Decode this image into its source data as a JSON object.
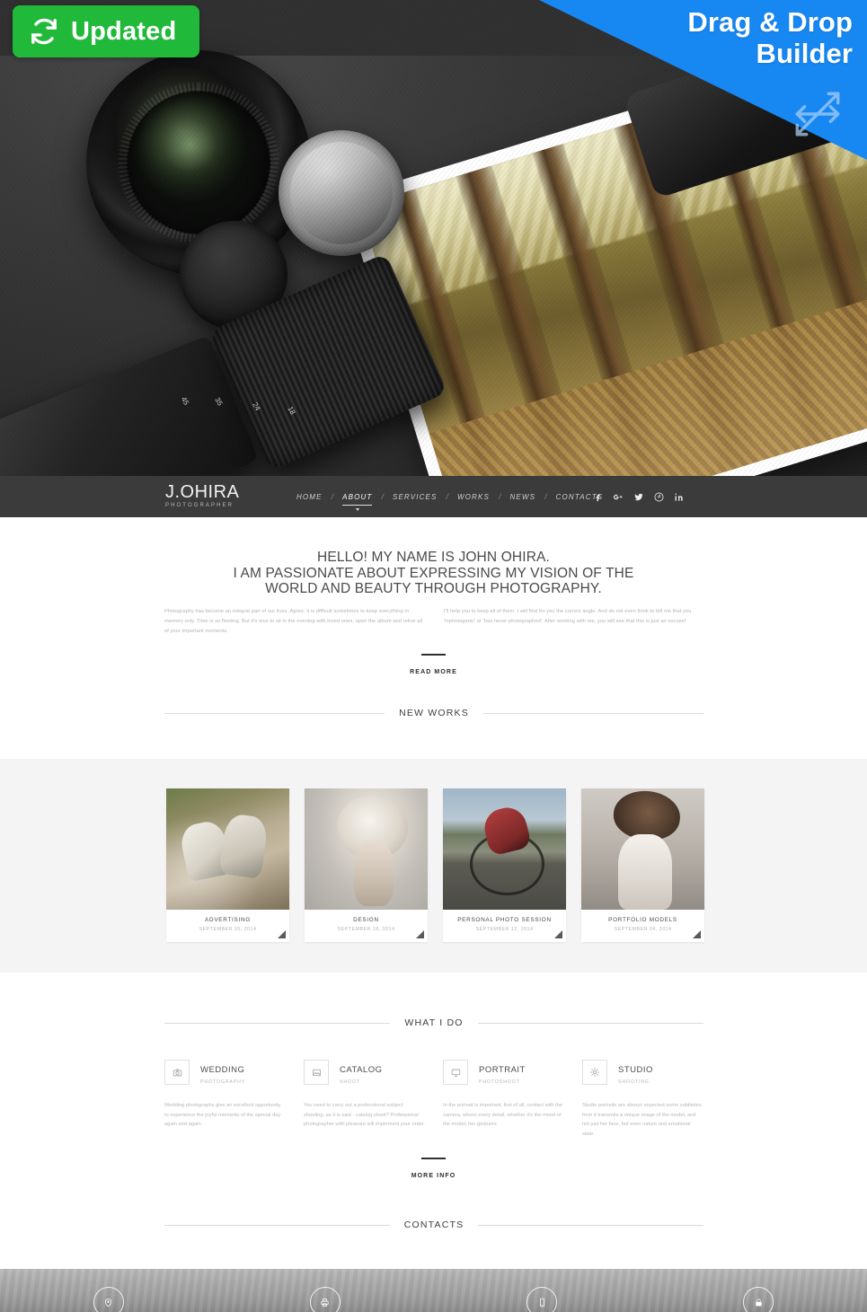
{
  "badges": {
    "updated_label": "Updated",
    "updated_icon": "refresh-icon",
    "updated_color": "#20b93a",
    "builder_line1": "Drag & Drop",
    "builder_line2": "Builder",
    "builder_color": "#1787f2",
    "builder_icon": "four-way-arrow-icon"
  },
  "nav": {
    "brand_title": "J.OHIRA",
    "brand_subtitle": "PHOTOGRAPHER",
    "separator": "/",
    "items": [
      {
        "label": "HOME",
        "active": false
      },
      {
        "label": "ABOUT",
        "active": true
      },
      {
        "label": "SERVICES",
        "active": false
      },
      {
        "label": "WORKS",
        "active": false
      },
      {
        "label": "NEWS",
        "active": false
      },
      {
        "label": "CONTACTS",
        "active": false
      }
    ],
    "social": [
      {
        "name": "facebook-icon",
        "glyph": "f"
      },
      {
        "name": "google-plus-icon",
        "glyph": "g+"
      },
      {
        "name": "twitter-icon",
        "glyph": "t"
      },
      {
        "name": "pinterest-icon",
        "glyph": "p"
      },
      {
        "name": "linkedin-icon",
        "glyph": "in"
      }
    ]
  },
  "intro": {
    "heading_line1": "HELLO! MY NAME IS JOHN OHIRA.",
    "heading_line2": "I AM PASSIONATE ABOUT EXPRESSING MY VISION OF THE",
    "heading_line3": "WORLD AND BEAUTY THROUGH PHOTOGRAPHY.",
    "paragraph_left": "Photography has become an integral part of our lives. Agree, it is difficult sometimes to keep everything in memory only. Time is so fleeting. But it's nice to sit in the evening with loved ones, open the album and relive all of your important moments.",
    "paragraph_right": "I'll help you to keep all of them. I will find for you the correct angle. And do not even think to tell me that you 'inphotogenic' or 'has never photographed'. After working with me, you will see that this is just an excuse!",
    "read_more_label": "READ MORE"
  },
  "new_works": {
    "section_title": "NEW WORKS",
    "items": [
      {
        "title": "ADVERTISING",
        "date": "SEPTEMBER 20, 2014",
        "thumb": "running-shoes-photo"
      },
      {
        "title": "DESIGN",
        "date": "SEPTEMBER 18, 2014",
        "thumb": "blonde-model-photo"
      },
      {
        "title": "PERSONAL PHOTO SESSION",
        "date": "SEPTEMBER 12, 2014",
        "thumb": "cyclist-photo"
      },
      {
        "title": "PORTFOLIO MODELS",
        "date": "SEPTEMBER 04, 2014",
        "thumb": "fashion-model-photo"
      }
    ]
  },
  "what_i_do": {
    "section_title": "WHAT I DO",
    "items": [
      {
        "icon": "camera-icon",
        "title": "WEDDING",
        "subtitle": "PHOTOGRAPHY",
        "text": "Wedding photographs give an excellent opportunity to experience the joyful moments of the special day again and again."
      },
      {
        "icon": "image-icon",
        "title": "CATALOG",
        "subtitle": "SHOOT",
        "text": "You need to carry out a professional subject shooting, as it is said - catalog shoot? Professional photographer with pleasure will implement your order."
      },
      {
        "icon": "monitor-icon",
        "title": "PORTRAIT",
        "subtitle": "PHOTOSHOOT",
        "text": "In the portrait is important, first of all, contact with the camera, where every detail, whether it's the mood of the model, her gestures."
      },
      {
        "icon": "sun-icon",
        "title": "STUDIO",
        "subtitle": "SHOOTING",
        "text": "Studio portraits are always expected some subtleties from  it transmits a unique image of the model, and not just her face, but even nature and emotional state."
      }
    ],
    "more_info_label": "MORE INFO"
  },
  "contacts": {
    "section_title": "CONTACTS",
    "icons": [
      {
        "name": "location-pin-icon"
      },
      {
        "name": "fax-icon"
      },
      {
        "name": "mobile-phone-icon"
      },
      {
        "name": "lock-icon"
      }
    ]
  }
}
